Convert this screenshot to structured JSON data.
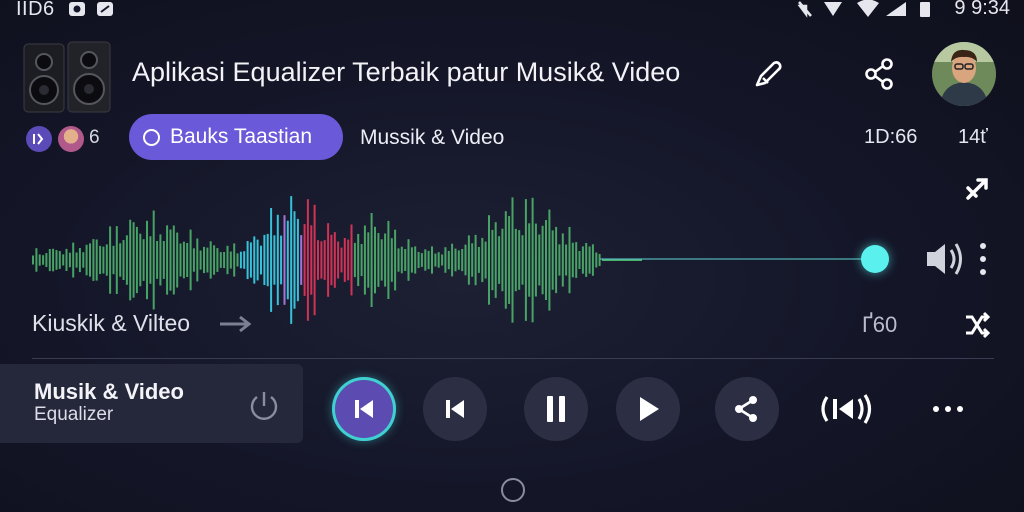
{
  "status_bar": {
    "left_text": "IID6",
    "right_text": "9 9:34"
  },
  "header": {
    "title": "Aplikasi Equalizer Terbaik patur Musik& Video",
    "icons": [
      "edit-icon",
      "share-icon"
    ],
    "avatar": "user-avatar"
  },
  "subheader": {
    "count": "6",
    "primary_button": "Bauks Taastian",
    "category": "Mussik & Video",
    "elapsed": "1D:66",
    "total": "14ť"
  },
  "player": {
    "track_label": "Kiuskik & Vilteo",
    "counter": "Ґ60",
    "progress": 0.84,
    "accent": "#59f0ee",
    "wave_colors": [
      "#4caf6a",
      "#3ad0e8",
      "#e0355a",
      "#b07ce8"
    ]
  },
  "now_playing": {
    "title": "Musik & Video",
    "subtitle": "Equalizer"
  },
  "controls": [
    "previous-active",
    "previous",
    "pause",
    "play",
    "share",
    "cast",
    "more"
  ],
  "colors": {
    "primary": "#6a59d8",
    "background": "#15172a",
    "accent": "#59f0ee"
  }
}
